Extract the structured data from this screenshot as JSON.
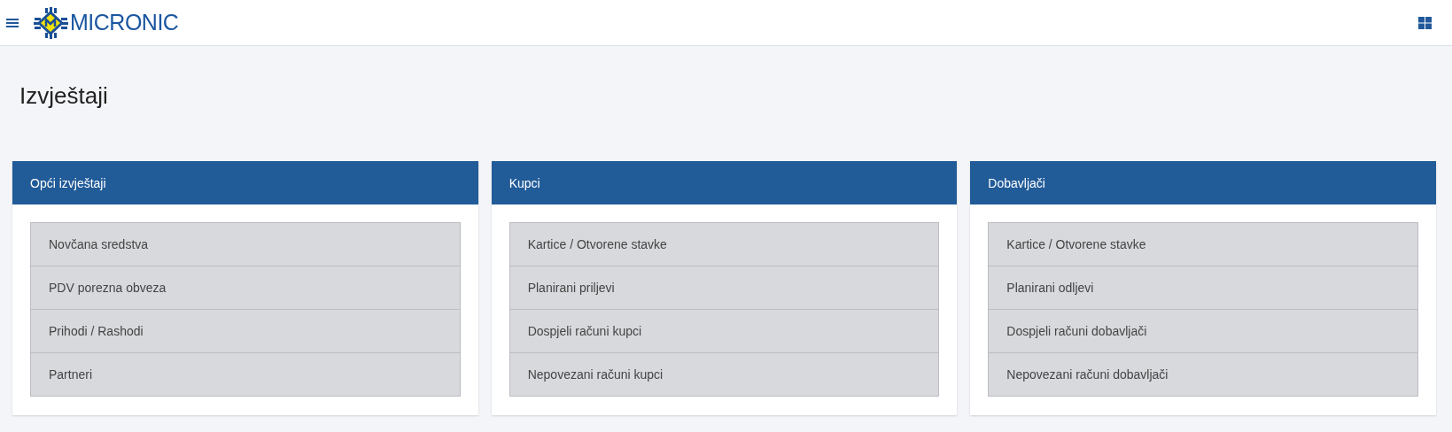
{
  "header": {
    "logo_text": "MICRONIC"
  },
  "page_title": "Izvještaji",
  "panels": [
    {
      "title": "Opći izvještaji",
      "items": [
        "Novčana sredstva",
        "PDV porezna obveza",
        "Prihodi / Rashodi",
        "Partneri"
      ]
    },
    {
      "title": "Kupci",
      "items": [
        "Kartice / Otvorene stavke",
        "Planirani priljevi",
        "Dospjeli računi kupci",
        "Nepovezani računi kupci"
      ]
    },
    {
      "title": "Dobavljači",
      "items": [
        "Kartice / Otvorene stavke",
        "Planirani odljevi",
        "Dospjeli računi dobavljači",
        "Nepovezani računi dobavljači"
      ]
    }
  ]
}
